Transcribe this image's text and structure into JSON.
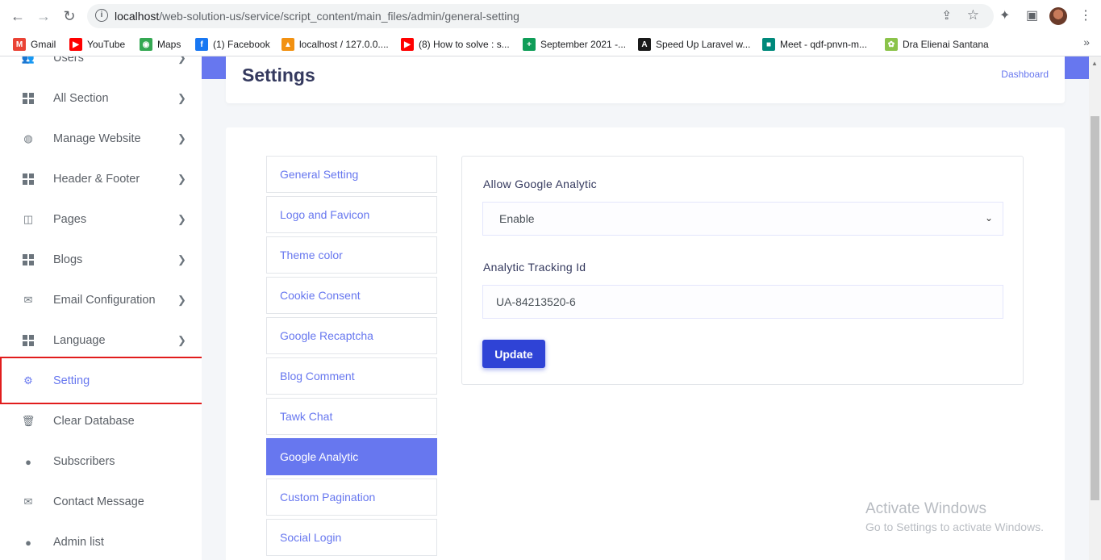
{
  "browser": {
    "url_host": "localhost",
    "url_path": "/web-solution-us/service/script_content/main_files/admin/general-setting",
    "bookmarks": [
      {
        "label": "Gmail",
        "icon": "gmail-icon",
        "color": "#ea4335",
        "glyph": "M"
      },
      {
        "label": "YouTube",
        "icon": "youtube-icon",
        "color": "#ff0000",
        "glyph": "▶"
      },
      {
        "label": "Maps",
        "icon": "maps-icon",
        "color": "#34a853",
        "glyph": "◉"
      },
      {
        "label": "(1) Facebook",
        "icon": "facebook-icon",
        "color": "#1877f2",
        "glyph": "f"
      },
      {
        "label": "localhost / 127.0.0....",
        "icon": "phpmyadmin-icon",
        "color": "#f29111",
        "glyph": "▲"
      },
      {
        "label": "(8) How to solve : s...",
        "icon": "youtube-icon",
        "color": "#ff0000",
        "glyph": "▶"
      },
      {
        "label": "September 2021 -...",
        "icon": "sheets-icon",
        "color": "#0f9d58",
        "glyph": "+"
      },
      {
        "label": "Speed Up Laravel w...",
        "icon": "laravel-icon",
        "color": "#1a1a1a",
        "glyph": "A"
      },
      {
        "label": "Meet - qdf-pnvn-m...",
        "icon": "meet-icon",
        "color": "#00897b",
        "glyph": "■"
      },
      {
        "label": "Dra Elienai Santana",
        "icon": "site-icon",
        "color": "#8bc34a",
        "glyph": "✿"
      }
    ]
  },
  "sidebar": {
    "items": [
      {
        "label": "Users",
        "icon": "users-icon",
        "chevron": true
      },
      {
        "label": "All Section",
        "icon": "grid-icon",
        "chevron": true
      },
      {
        "label": "Manage Website",
        "icon": "globe-icon",
        "chevron": true
      },
      {
        "label": "Header & Footer",
        "icon": "grid-icon",
        "chevron": true
      },
      {
        "label": "Pages",
        "icon": "columns-icon",
        "chevron": true
      },
      {
        "label": "Blogs",
        "icon": "grid-icon",
        "chevron": true
      },
      {
        "label": "Email Configuration",
        "icon": "envelope-icon",
        "chevron": true
      },
      {
        "label": "Language",
        "icon": "grid-icon",
        "chevron": true
      },
      {
        "label": "Setting",
        "icon": "gear-icon",
        "chevron": false,
        "active": true
      },
      {
        "label": "Clear Database",
        "icon": "trash-icon",
        "chevron": false
      },
      {
        "label": "Subscribers",
        "icon": "fire-icon",
        "chevron": false
      },
      {
        "label": "Contact Message",
        "icon": "envelope-icon",
        "chevron": false
      },
      {
        "label": "Admin list",
        "icon": "user-icon",
        "chevron": false
      }
    ]
  },
  "header": {
    "title": "Settings",
    "breadcrumb": "Dashboard"
  },
  "tabs": [
    {
      "label": "General Setting"
    },
    {
      "label": "Logo and Favicon"
    },
    {
      "label": "Theme color"
    },
    {
      "label": "Cookie Consent"
    },
    {
      "label": "Google Recaptcha"
    },
    {
      "label": "Blog Comment"
    },
    {
      "label": "Tawk Chat"
    },
    {
      "label": "Google Analytic",
      "active": true
    },
    {
      "label": "Custom Pagination"
    },
    {
      "label": "Social Login"
    }
  ],
  "form": {
    "allow_label": "Allow Google Analytic",
    "allow_value": "Enable",
    "tracking_label": "Analytic Tracking Id",
    "tracking_value": "UA-84213520-6",
    "submit_label": "Update"
  },
  "watermark": {
    "line1": "Activate Windows",
    "line2": "Go to Settings to activate Windows."
  },
  "colors": {
    "accent": "#6777ef",
    "button": "#2f43d6",
    "highlight": "#e11d1d"
  }
}
